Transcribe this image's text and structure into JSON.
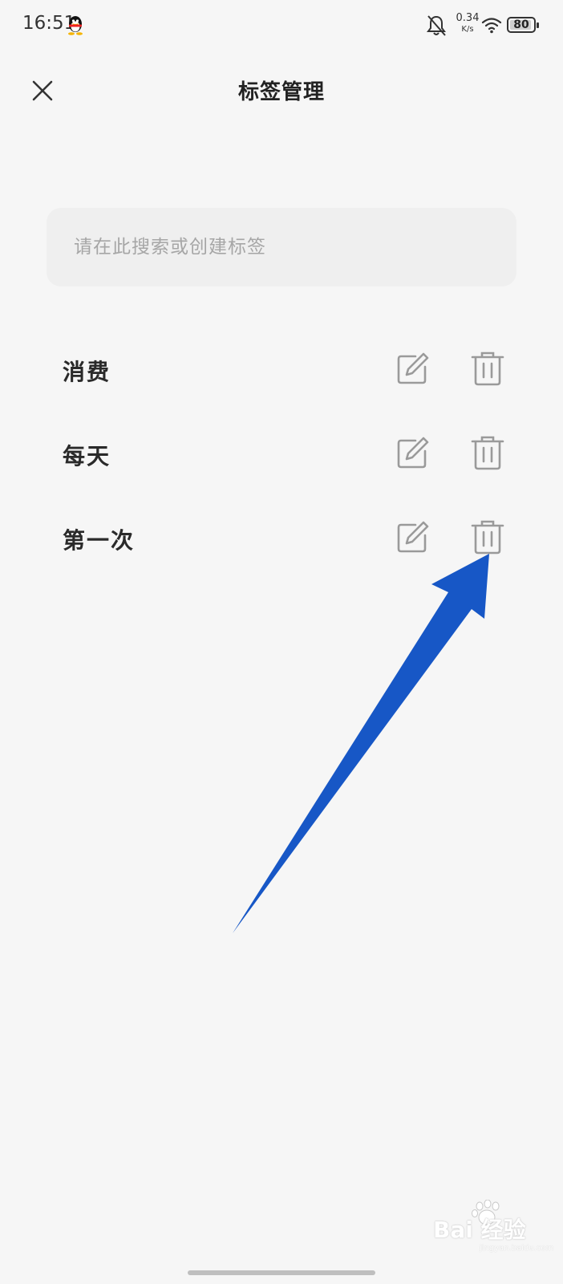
{
  "status_bar": {
    "time": "16:51",
    "network_speed_value": "0.34",
    "network_speed_unit": "K/s",
    "battery_level": "80",
    "icons": [
      "qq-icon",
      "bell-off-icon",
      "wifi-icon",
      "battery-icon"
    ]
  },
  "header": {
    "title": "标签管理",
    "close_icon": "close-icon"
  },
  "search": {
    "placeholder": "请在此搜索或创建标签",
    "value": ""
  },
  "tags": [
    {
      "label": "消费",
      "edit_icon": "edit-icon",
      "delete_icon": "trash-icon"
    },
    {
      "label": "每天",
      "edit_icon": "edit-icon",
      "delete_icon": "trash-icon"
    },
    {
      "label": "第一次",
      "edit_icon": "edit-icon",
      "delete_icon": "trash-icon"
    }
  ],
  "annotation": {
    "arrow_color": "#1757c6"
  },
  "watermark": {
    "text": "Bai 经验",
    "site": "jingyan.baidu.com"
  },
  "colors": {
    "background": "#f6f6f6",
    "search_bg": "#efefef",
    "icon_gray": "#9a9a9a"
  }
}
